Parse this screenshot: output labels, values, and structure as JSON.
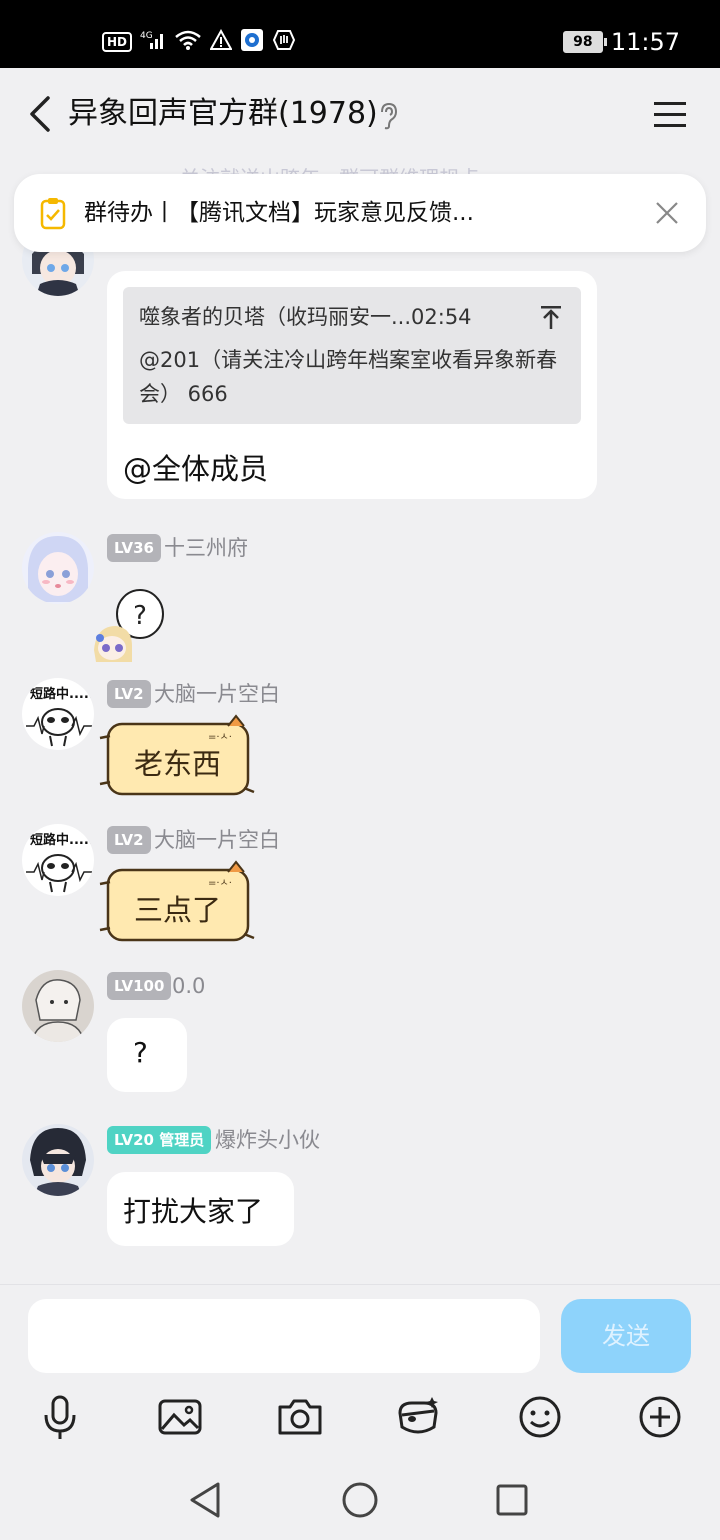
{
  "status_bar": {
    "hd": "HD",
    "network": "4G",
    "battery": "98",
    "time": "11:57"
  },
  "header": {
    "title": "异象回声官方群(1978)"
  },
  "faded_notice": "关注就送山跨年 · 群可群维理规点",
  "todo": {
    "text": "群待办丨【腾讯文档】玩家意见反馈..."
  },
  "messages": [
    {
      "quote_header": "噬象者的贝塔（收玛丽安一...02:54",
      "quote_text": "@201（请关注冷山跨年档案室收看异象新春会） 666",
      "text": "@全体成员"
    },
    {
      "level": "LV36",
      "name": "十三州府",
      "sticker_text": "?"
    },
    {
      "level": "LV2",
      "name": "大脑一片空白",
      "avatar_text": "短路中......",
      "text": "老东西"
    },
    {
      "level": "LV2",
      "name": "大脑一片空白",
      "avatar_text": "短路中......",
      "text": "三点了"
    },
    {
      "level": "LV100",
      "name": "0.0",
      "text": "?"
    },
    {
      "level": "LV20 管理员",
      "name": "爆炸头小伙",
      "text": "打扰大家了"
    }
  ],
  "input": {
    "send_label": "发送"
  },
  "toolbar": [
    "microphone-icon",
    "image-icon",
    "camera-icon",
    "hongbao-icon",
    "emoji-icon",
    "plus-icon"
  ],
  "colors": {
    "background": "#f0f0f2",
    "bubble": "#ffffff",
    "send_button": "#8ed3fb",
    "admin_badge": "#4fd3c4",
    "level_badge": "#b3b3b8",
    "cat_bubble": "#ffe9b0"
  }
}
